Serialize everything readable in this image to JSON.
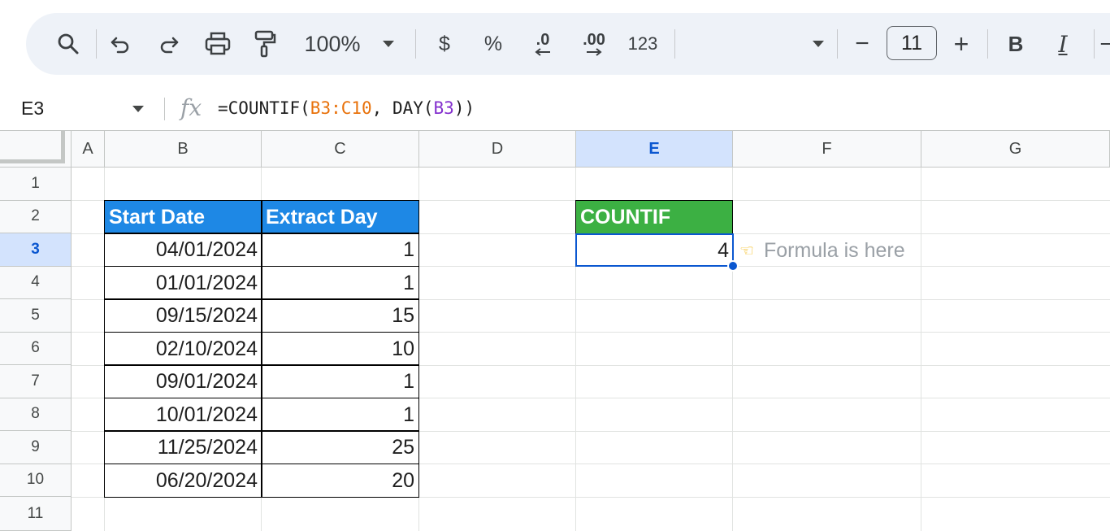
{
  "toolbar": {
    "zoom": "100%",
    "currency": "$",
    "percent": "%",
    "decrease_decimal": ".0",
    "increase_decimal": ".00",
    "number_format": "123",
    "font_size": "11",
    "minus": "−",
    "plus": "+",
    "bold": "B",
    "italic": "I"
  },
  "formula_bar": {
    "cell_ref": "E3",
    "fx": "fx",
    "formula_prefix": "=COUNTIF(",
    "formula_range": "B3:C10",
    "formula_mid": ", DAY(",
    "formula_ref": "B3",
    "formula_suffix": "))"
  },
  "columns": [
    "A",
    "B",
    "C",
    "D",
    "E",
    "F",
    "G"
  ],
  "rows": [
    "1",
    "2",
    "3",
    "4",
    "5",
    "6",
    "7",
    "8",
    "9",
    "10",
    "11"
  ],
  "selected": {
    "column": "E",
    "row": "3"
  },
  "table": {
    "headers": [
      "Start Date",
      "Extract Day"
    ],
    "rows": [
      [
        "04/01/2024",
        "1"
      ],
      [
        "01/01/2024",
        "1"
      ],
      [
        "09/15/2024",
        "15"
      ],
      [
        "02/10/2024",
        "10"
      ],
      [
        "09/01/2024",
        "1"
      ],
      [
        "10/01/2024",
        "1"
      ],
      [
        "11/25/2024",
        "25"
      ],
      [
        "06/20/2024",
        "20"
      ]
    ]
  },
  "countif": {
    "header": "COUNTIF",
    "value": "4",
    "note": "Formula is here",
    "note_icon": "pointing-hand-icon"
  },
  "colors": {
    "header_blue": "#1e88e5",
    "header_green": "#3cb043",
    "selection": "#0b57d0"
  }
}
